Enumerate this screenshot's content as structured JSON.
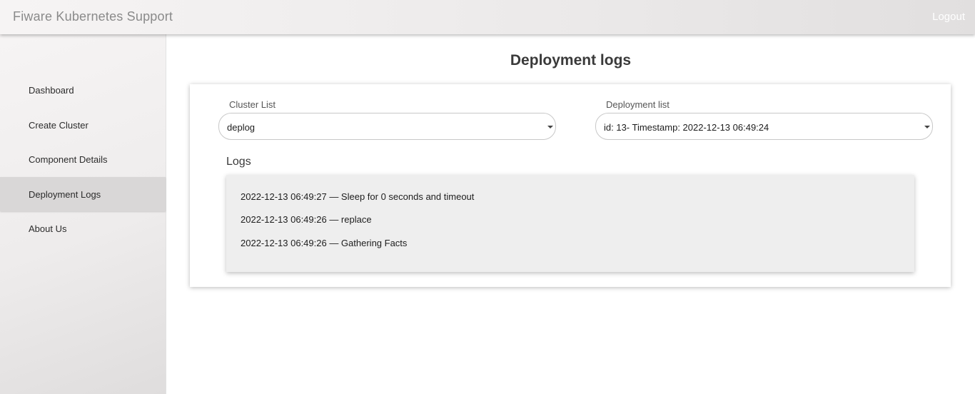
{
  "header": {
    "app_title": "Fiware Kubernetes Support",
    "logout_label": "Logout"
  },
  "sidebar": {
    "items": [
      {
        "label": "Dashboard",
        "icon": ""
      },
      {
        "label": "Create Cluster",
        "icon": ""
      },
      {
        "label": "Component Details",
        "icon": ""
      },
      {
        "label": "Deployment Logs",
        "icon": "",
        "active": true
      },
      {
        "label": "About Us",
        "icon": ""
      }
    ]
  },
  "main": {
    "title": "Deployment logs",
    "cluster_list": {
      "label": "Cluster List",
      "selected": "deplog"
    },
    "deployment_list": {
      "label": "Deployment list",
      "selected": "id: 13- Timestamp: 2022-12-13 06:49:24"
    },
    "logs": {
      "heading": "Logs",
      "lines": [
        "2022-12-13 06:49:27 — Sleep for 0 seconds and timeout",
        "2022-12-13 06:49:26 — replace",
        "2022-12-13 06:49:26 — Gathering Facts"
      ]
    }
  },
  "colors": {
    "active_nav": "#d9d7d7",
    "header_gradient_start": "#f6f4f4",
    "log_box": "#eeeeee"
  }
}
